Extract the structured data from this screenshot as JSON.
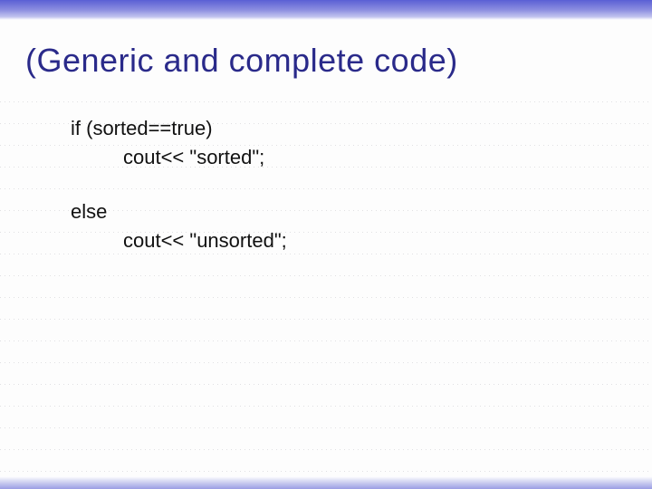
{
  "title": "(Generic and complete code)",
  "code": {
    "line1": "if (sorted==true)",
    "line2": "cout<< \"sorted\";",
    "line3": "else",
    "line4": "cout<< \"unsorted\";"
  }
}
